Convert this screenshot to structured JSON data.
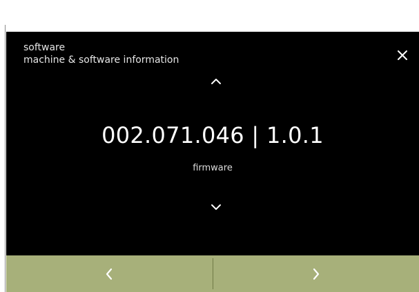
{
  "header": {
    "title": "software",
    "subtitle": "machine & software information"
  },
  "main": {
    "value": "002.071.046 | 1.0.1",
    "caption": "firmware"
  },
  "icons": {
    "close": "close-icon",
    "scroll_up": "chevron-up-icon",
    "scroll_down": "chevron-down-icon",
    "previous": "chevron-left-icon",
    "next": "chevron-right-icon"
  },
  "colors": {
    "screen_background": "#000000",
    "footer_background": "#a7b07a",
    "text": "#ffffff"
  }
}
